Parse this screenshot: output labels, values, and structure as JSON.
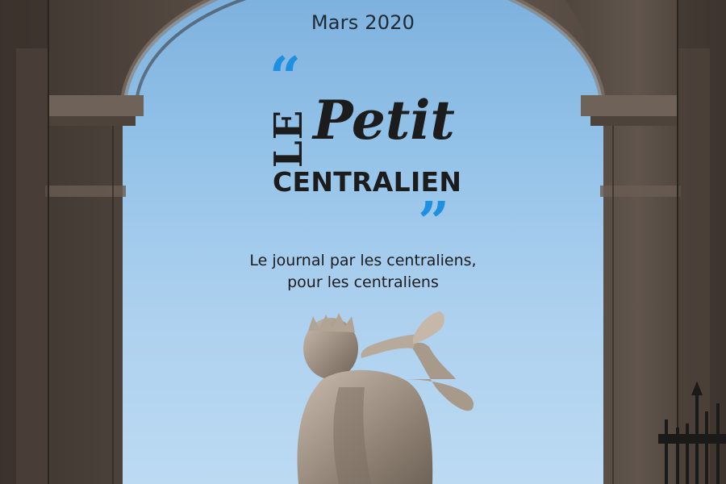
{
  "cover": {
    "date": "Mars 2020",
    "quote_open": "“",
    "quote_close": "”",
    "logo": {
      "le": "LE",
      "petit": "Petit",
      "centralien": "CENTRALIEN"
    },
    "tagline_line1": "Le journal par les centraliens,",
    "tagline_line2": "pour les centraliens"
  },
  "colors": {
    "quote_accent": "#1e90e0",
    "text_dark": "#1c1c1c",
    "sky": "#93c2e8",
    "stone": "#5e524a"
  },
  "icons": {
    "statue": "statue-photo",
    "arch": "stone-arch"
  }
}
